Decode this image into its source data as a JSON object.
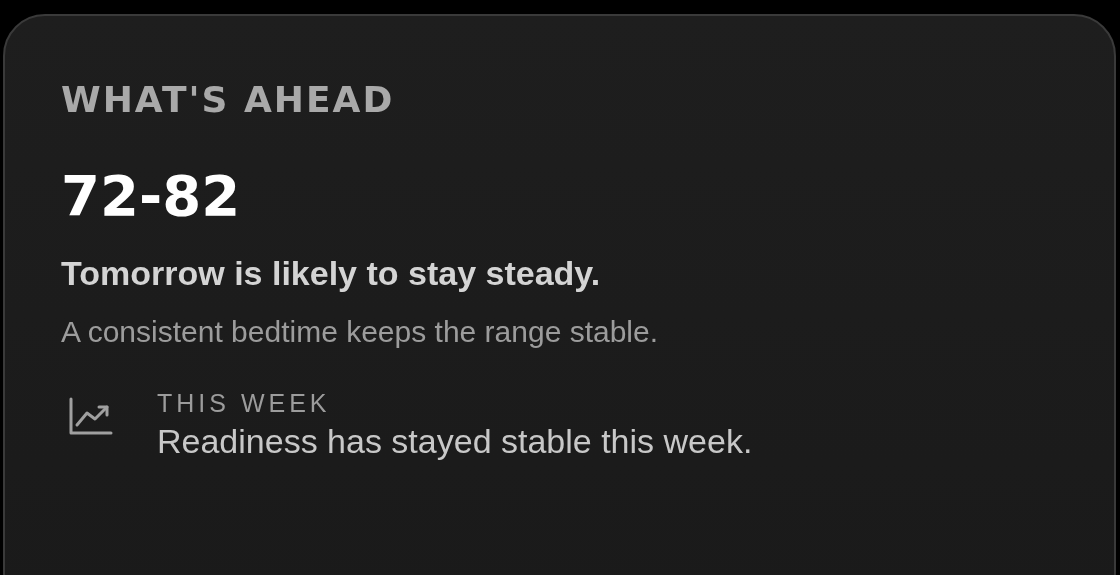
{
  "card": {
    "title": "WHAT'S AHEAD",
    "range": "72-82",
    "headline": "Tomorrow is likely to stay steady.",
    "note": "A consistent bedtime keeps the range stable.",
    "insight": {
      "label": "THIS WEEK",
      "text": "Readiness has stayed stable this week."
    }
  }
}
